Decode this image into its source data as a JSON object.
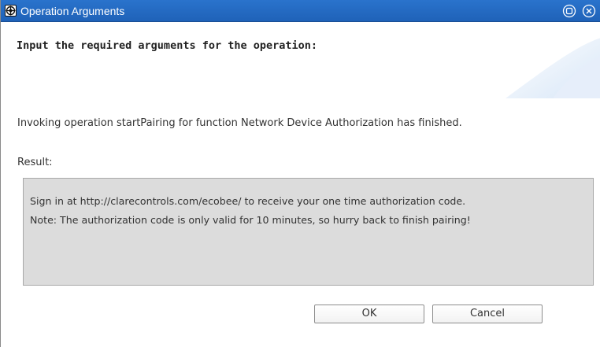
{
  "window": {
    "title": "Operation Arguments",
    "title_bar_color": "#1f62b8",
    "icons": {
      "app": "gear-icon",
      "restore": "restore-icon",
      "close": "close-icon"
    }
  },
  "header": {
    "instruction": "Input the required arguments for the operation:"
  },
  "body": {
    "status_message": "Invoking operation startPairing for function Network Device Authorization has finished.",
    "result_label": "Result:",
    "result_lines": [
      "Sign in at http://clarecontrols.com/ecobee/ to receive your one time authorization code.",
      "Note: The authorization code is only valid for 10 minutes, so hurry back to finish pairing!"
    ],
    "result_bg_color": "#dcdcdc"
  },
  "buttons": {
    "ok_label": "OK",
    "cancel_label": "Cancel"
  }
}
